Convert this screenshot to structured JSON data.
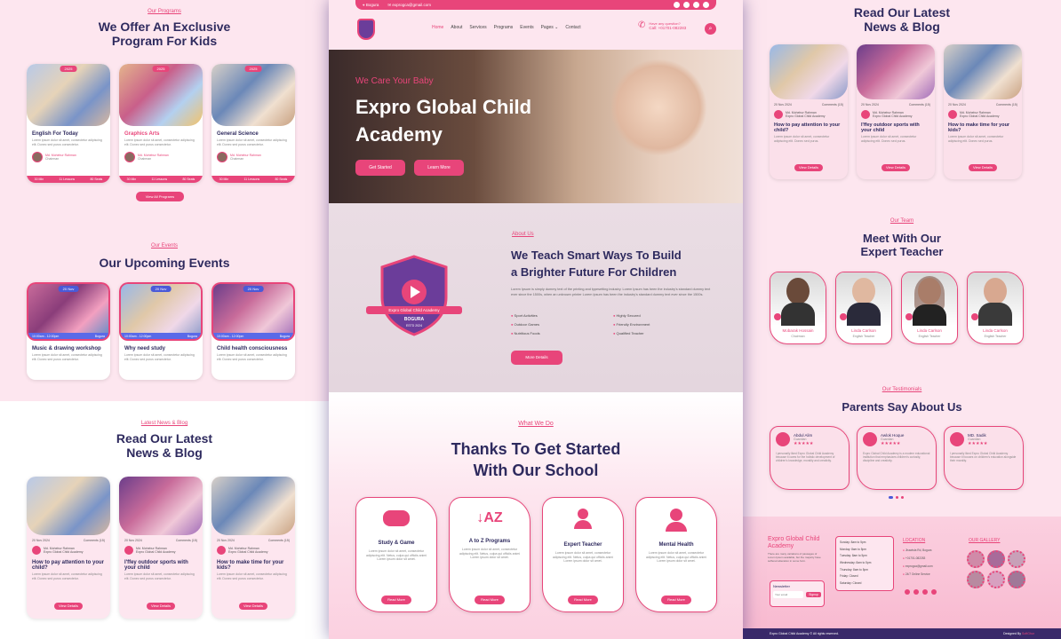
{
  "left": {
    "programs": {
      "eyebrow": "Our Programs",
      "title_line1": "We Offer An Exclusive",
      "title_line2": "Program For Kids",
      "button": "View All Programs",
      "cards": [
        {
          "tag": "2025",
          "title": "English For Today",
          "text": "Lorem ipsum dolor sit amet, consectetur adipiscing elit. Donec sed purus consectetur.",
          "author": "Md. Mohebur Rahman",
          "role": "Chairman",
          "meta1": "30 Min",
          "meta2": "11 Lessons",
          "meta3": "80 Seats"
        },
        {
          "tag": "2025",
          "title": "Graphics Arts",
          "text": "Lorem ipsum dolor sit amet, consectetur adipiscing elit. Donec sed purus consectetur.",
          "author": "Md. Mohebur Rahman",
          "role": "Chairman",
          "meta1": "30 Min",
          "meta2": "11 Lessons",
          "meta3": "80 Seats"
        },
        {
          "tag": "2025",
          "title": "General Science",
          "text": "Lorem ipsum dolor sit amet, consectetur adipiscing elit. Donec sed purus consectetur.",
          "author": "Md. Mohebur Rahman",
          "role": "Chairman",
          "meta1": "30 Min",
          "meta2": "11 Lessons",
          "meta3": "80 Seats"
        }
      ]
    },
    "events": {
      "eyebrow": "Our Events",
      "title": "Our Upcoming Events",
      "cards": [
        {
          "tag": "20 Nov",
          "time": "10:00am - 12:00pm",
          "loc": "Bogura",
          "title": "Music & drawing workshop",
          "text": "Lorem ipsum dolor sit amet, consectetur adipiscing elit. Donec sed purus consectetur."
        },
        {
          "tag": "20 Nov",
          "time": "10:00am - 12:00pm",
          "loc": "Bogura",
          "title": "Why need study",
          "text": "Lorem ipsum dolor sit amet, consectetur adipiscing elit. Donec sed purus consectetur."
        },
        {
          "tag": "20 Nov",
          "time": "10:00am - 12:00pm",
          "loc": "Bogura",
          "title": "Child health consciousness",
          "text": "Lorem ipsum dolor sit amet, consectetur adipiscing elit. Donec sed purus consectetur."
        }
      ]
    },
    "news": {
      "eyebrow": "Latest News & Blog",
      "title_line1": "Read Our Latest",
      "title_line2": "News & Blog",
      "cards": [
        {
          "date": "20 Nov 2024",
          "comments": "Comments (15)",
          "author": "Md. Mohebur Rahman",
          "org": "Expro Global Child Academy",
          "title": "How to pay attention to your child?",
          "text": "Lorem ipsum dolor sit amet, consectetur adipiscing elit. Donec sed purus consectetur.",
          "button": "View Details"
        },
        {
          "date": "20 Nov 2024",
          "comments": "Comments (15)",
          "author": "Md. Mohebur Rahman",
          "org": "Expro Global Child Academy",
          "title": "I'ffey outdoor sports with your child",
          "text": "Lorem ipsum dolor sit amet, consectetur adipiscing elit. Donec sed purus consectetur.",
          "button": "View Details"
        },
        {
          "date": "20 Nov 2024",
          "comments": "Comments (15)",
          "author": "Md. Mohebur Rahman",
          "org": "Expro Global Child Academy",
          "title": "How to make time for your kids?",
          "text": "Lorem ipsum dolor sit amet, consectetur adipiscing elit. Donec sed purus consectetur.",
          "button": "View Details"
        }
      ]
    }
  },
  "center": {
    "topbar": {
      "location": "Bogura",
      "email": "exprogca@gmail.com"
    },
    "nav": [
      "Home",
      "About",
      "Services",
      "Programs",
      "Events",
      "Pages",
      "Contact"
    ],
    "nav_dropdown_suffix": "⌄",
    "question_label": "Have any question?",
    "phone": "Call: +01701-082283",
    "hero": {
      "kicker": "We Care Your Baby",
      "title_line1": "Expro Global Child",
      "title_line2": "Academy",
      "btn1": "Get Started",
      "btn2": "Learn More"
    },
    "about": {
      "eyebrow": "About Us",
      "title_line1": "We Teach Smart Ways To Build",
      "title_line2": "a Brighter Future For Children",
      "text": "Lorem Ipsum is simply dummy text of the printing and typesetting industry. Lorem Ipsum has been the industry's standard dummy text ever since the 1500s, when an unknown printer Lorem Ipsum has been the industry's standard dummy text ever since the 1500s.",
      "features": [
        "Sport Activities",
        "Highly Secured",
        "Outdoor Games",
        "Friendly Environment",
        "Nutritious Foods",
        "Qualified Teacher"
      ],
      "button": "More Details",
      "logo_text": "Expro Global Child Academy",
      "logo_city": "BOGURA",
      "logo_estd": "ESTD 2024"
    },
    "services": {
      "eyebrow": "What We Do",
      "title_line1": "Thanks To Get Started",
      "title_line2": "With Our School",
      "cards": [
        {
          "icon": "gamepad-icon",
          "title": "Study & Game",
          "text": "Lorem ipsum dolor sit amet, consectetur adipiscing elit. Netus, culpa qui officiis animi Lorem ipsum dolor sit amet.",
          "button": "Read More"
        },
        {
          "icon": "sort-az-icon",
          "title": "A to Z Programs",
          "text": "Lorem ipsum dolor sit amet, consectetur adipiscing elit. Netus, culpa qui officiis animi Lorem ipsum dolor sit amet.",
          "button": "Read More"
        },
        {
          "icon": "users-icon",
          "title": "Expert Teacher",
          "text": "Lorem ipsum dolor sit amet, consectetur adipiscing elit. Netus, culpa qui officiis animi Lorem ipsum dolor sit amet.",
          "button": "Read More"
        },
        {
          "icon": "nurse-icon",
          "title": "Mental Health",
          "text": "Lorem ipsum dolor sit amet, consectetur adipiscing elit. Netus, culpa qui officiis animi Lorem ipsum dolor sit amet.",
          "button": "Read More"
        }
      ]
    }
  },
  "right": {
    "news": {
      "title_line1": "Read Our Latest",
      "title_line2": "News & Blog",
      "cards": [
        {
          "date": "20 Nov 2024",
          "comments": "Comments (15)",
          "author": "Md. Mohebur Rahman",
          "org": "Expro Global Child Academy",
          "title": "How to pay attention to your child?",
          "text": "Lorem ipsum dolor sit amet, consectetur adipiscing elit. Donec sed purus.",
          "button": "View Details"
        },
        {
          "date": "20 Nov 2024",
          "comments": "Comments (15)",
          "author": "Md. Mohebur Rahman",
          "org": "Expro Global Child Academy",
          "title": "I'ffey outdoor sports with your child",
          "text": "Lorem ipsum dolor sit amet, consectetur adipiscing elit. Donec sed purus.",
          "button": "View Details"
        },
        {
          "date": "20 Nov 2024",
          "comments": "Comments (15)",
          "author": "Md. Mohebur Rahman",
          "org": "Expro Global Child Academy",
          "title": "How to make time for your kids?",
          "text": "Lorem ipsum dolor sit amet, consectetur adipiscing elit. Donec sed purus.",
          "button": "View Details"
        }
      ]
    },
    "team": {
      "eyebrow": "Our Team",
      "title_line1": "Meet With Our",
      "title_line2": "Expert Teacher",
      "members": [
        {
          "name": "Mobarak Hossain",
          "role": "Chairman"
        },
        {
          "name": "Linda Carlson",
          "role": "English Teacher"
        },
        {
          "name": "Linda Carlson",
          "role": "English Teacher"
        },
        {
          "name": "Linda Carlson",
          "role": "English Teacher"
        }
      ]
    },
    "testimonials": {
      "eyebrow": "Our Testimonials",
      "title": "Parents Say About Us",
      "items": [
        {
          "name": "Abdul Alim",
          "role": "Guardian",
          "stars": "★★★★★",
          "text": "I personally liked Expro Global Child Academy because it cares for the holistic development of children's knowledge, morality and creativity."
        },
        {
          "name": "Awlok Hoque",
          "role": "Guardian",
          "stars": "★★★★★",
          "text": "Expro Global Child Academy is a modern educational institution that emphasizes children's curiosity, discipline and creativity."
        },
        {
          "name": "MD. Sadik",
          "role": "Guardian",
          "stars": "★★★★★",
          "text": "I personally liked Expro Global Child Academy because it focuses on children's education alongside their morality."
        }
      ]
    },
    "footer": {
      "brand_line1": "Expro Global Child",
      "brand_line2": "Academy",
      "about": "There are many variations of passages of Lorem Ipsum available, but the majority have suffered alteration in some form.",
      "newsletter": "Newsletter",
      "email_placeholder": "Your email",
      "subscribe": "Signup",
      "hours": [
        "Sunday: 8am to 5pm",
        "Monday: 8am to 5pm",
        "Tuesday: 8am to 5pm",
        "Wednesday: 8am to 5pm",
        "Thursday: 8am to 5pm",
        "Friday: Closed",
        "Saturday: Closed"
      ],
      "location_title": "LOCATION",
      "locations": [
        "Jhawtola Rd, Bogura",
        "+01701-082283",
        "exprogca@gmail.com",
        "24/7 Online Service"
      ],
      "gallery_title": "OUR GALLERY",
      "copyright": "Expro Global Child Academy © All rights reserved.",
      "designed_by": "Designed By",
      "designer": "SoftGhor"
    }
  }
}
